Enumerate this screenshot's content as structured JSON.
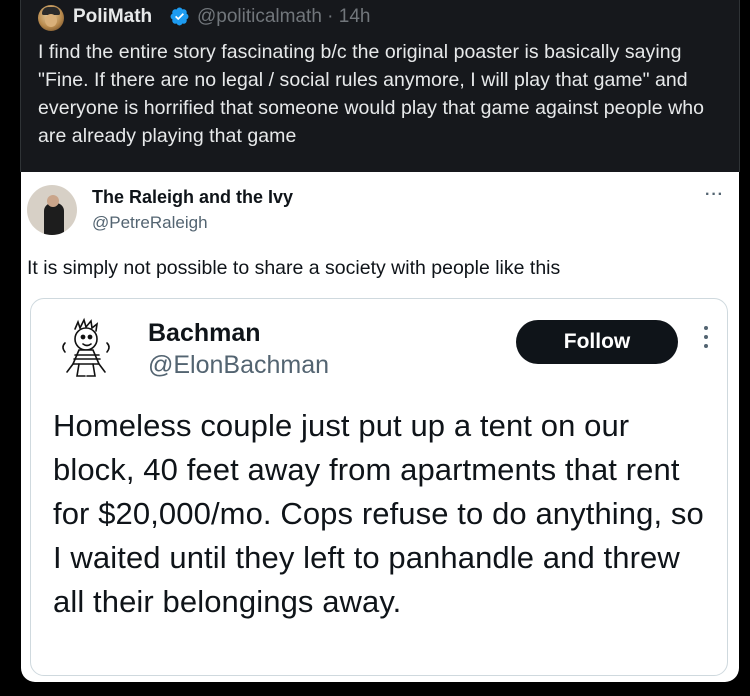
{
  "outer_tweet": {
    "display_name": "PoliMath",
    "handle_time": "@politicalmath · 14h",
    "text": "I find the entire story fascinating b/c the original poaster is basically saying \"Fine. If there are no legal / social rules anymore, I will play that game\" and everyone is horrified that someone would play that game against people who are already playing that game",
    "verified_icon": "verified-badge-icon"
  },
  "quote_tweet": {
    "display_name": "The Raleigh and the Ivy",
    "handle": "@PetreRaleigh",
    "more": "···",
    "text": "It is simply not possible to share a society with people like this"
  },
  "inner_tweet": {
    "display_name": "Bachman",
    "handle": "@ElonBachman",
    "follow_label": "Follow",
    "text": "Homeless couple just put up a tent on our block, 40 feet away from apartments that rent for $20,000/mo. Cops refuse to do anything, so I waited until they left to panhandle and threw all their belongings away."
  },
  "colors": {
    "dark_bg": "#16181c",
    "text_light": "#e7e9ea",
    "muted": "#71767b",
    "verified_blue": "#1d9bf0",
    "follow_bg": "#0f1419"
  }
}
